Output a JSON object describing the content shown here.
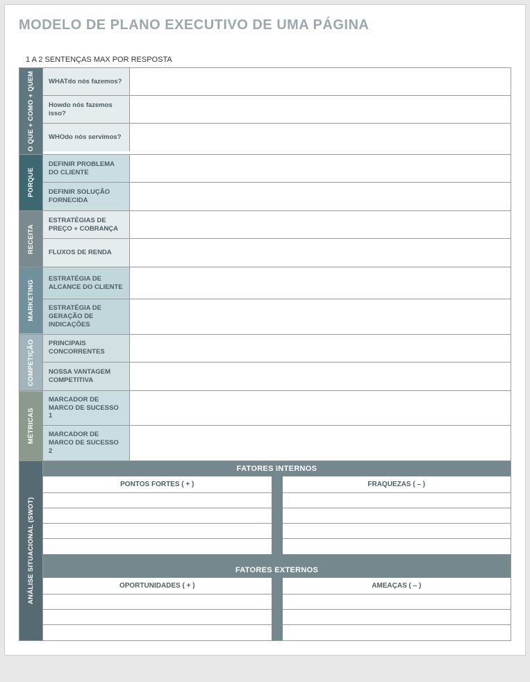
{
  "title": "MODELO DE PLANO EXECUTIVO DE UMA PÁGINA",
  "instruction": "1 A 2 SENTENÇAS MAX POR RESPOSTA",
  "sections": [
    {
      "label": "O QUE + COMO + QUEM",
      "rows": [
        {
          "label": "WHATdo nós fazemos?",
          "value": ""
        },
        {
          "label": "Howdo nós fazemos isso?",
          "value": ""
        },
        {
          "label": "WHOdo nós servimos?",
          "value": ""
        }
      ]
    },
    {
      "label": "PORQUE",
      "rows": [
        {
          "label": "DEFINIR PROBLEMA DO CLIENTE",
          "value": ""
        },
        {
          "label": "DEFINIR SOLUÇÃO FORNECIDA",
          "value": ""
        }
      ]
    },
    {
      "label": "RECEITA",
      "rows": [
        {
          "label": "ESTRATÉGIAS DE PREÇO + COBRANÇA",
          "value": ""
        },
        {
          "label": "FLUXOS DE RENDA",
          "value": ""
        }
      ]
    },
    {
      "label": "MARKETING",
      "rows": [
        {
          "label": "ESTRATÉGIA DE ALCANCE DO CLIENTE",
          "value": ""
        },
        {
          "label": "ESTRATÉGIA DE GERAÇÃO DE INDICAÇÕES",
          "value": ""
        }
      ]
    },
    {
      "label": "COMPETIÇÃO",
      "rows": [
        {
          "label": "PRINCIPAIS CONCORRENTES",
          "value": ""
        },
        {
          "label": "NOSSA VANTAGEM COMPETITIVA",
          "value": ""
        }
      ]
    },
    {
      "label": "MÉTRICAS",
      "rows": [
        {
          "label": "MARCADOR DE MARCO DE SUCESSO 1",
          "value": ""
        },
        {
          "label": "MARCADOR DE MARCO DE SUCESSO 2",
          "value": ""
        }
      ]
    }
  ],
  "swot": {
    "section_label": "ANÁLISE SITUACIONAL (SWOT)",
    "internal_banner": "FATORES INTERNOS",
    "external_banner": "FATORES EXTERNOS",
    "strengths_label": "PONTOS FORTES ( + )",
    "weaknesses_label": "FRAQUEZAS ( – )",
    "opportunities_label": "OPORTUNIDADES ( + )",
    "threats_label": "AMEAÇAS ( – )",
    "strengths": [
      "",
      "",
      "",
      ""
    ],
    "weaknesses": [
      "",
      "",
      "",
      ""
    ],
    "opportunities": [
      "",
      "",
      ""
    ],
    "threats": [
      "",
      "",
      ""
    ]
  }
}
